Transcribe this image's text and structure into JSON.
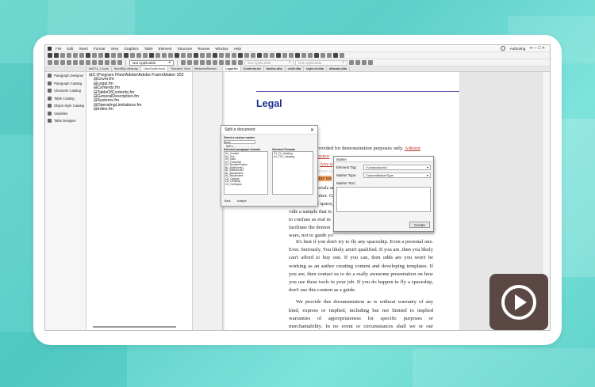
{
  "menu": [
    "File",
    "Edit",
    "Insert",
    "Format",
    "View",
    "Graphics",
    "Table",
    "Element",
    "Structure",
    "Review",
    "Window",
    "Help"
  ],
  "workspace_mode": "Authoring",
  "toolbar": {
    "selector1": "Not Applicable",
    "selector2": "Not Applicable",
    "selector3": "Not Applicable"
  },
  "left_panel": [
    "Paragraph Designer",
    "Paragraph Catalog",
    "Character Catalog",
    "Table Catalog",
    "Object Style Catalog",
    "Variables",
    "Table Designer"
  ],
  "mid_tabs": [
    "lab074_1.book",
    "WorkBkp.ditamap",
    "UserGuide.book",
    "Structure View"
  ],
  "tree": {
    "root": "C:\\Program Files\\Adobe\\Adobe FrameMaker 202",
    "files": [
      "Cover.fm",
      "Legal.fm",
      "Contents.fm",
      "TableOfContents.fm",
      "GeneralDescription.fm",
      "Systems.fm",
      "OperatingLimitations.fm",
      "Index.fm"
    ]
  },
  "doc_strip_title": "WelcomeScreen",
  "doc_tabs": [
    "Legal.fm",
    "Contents.fm",
    "taskbx.dita",
    "vesft.dita",
    "topicref.dita",
    "ditavals.dita"
  ],
  "document": {
    "title": "Legal",
    "frag1a": "rovided for demonstration purposes only. ",
    "frag1b": "Admini",
    "frag2": "erator",
    "frag3a": ". ",
    "frag3b": "Any u",
    "frag4": "Your lu",
    "frag5": "our we",
    "frag6": "erials ar",
    "frag7": "biter. Gr",
    "frag8": "l space,",
    "frag9": "vide a sample that is",
    "frag10": "to confuse as real m",
    "frag11": "facilitate the demon",
    "frag12": "ware, not to guide yo",
    "para1": "It's best if you don't try to fly any spaceship. Even a personal one. Ever. Seriously. You likely aren't qualified. If you are, then you likely can't afford to buy one. If you can, then odds are you won't be working as an author creating content and developing templates. If you are, then contact us to do a really awesome presentation on how you use these tools in your job. If you do happen to fly a spaceship, don't use this content as a guide.",
    "para2": "We provide this documentation as is without warranty of any kind, express or implied, including but not limited to implied warranties of appropriateness for specific purposes or merchantability. In no event or circumstances shall we or our suppliers or distributors be liable for any damages whatsoever, including and without limitation, damages resulting from business loss, which"
  },
  "split_dialog": {
    "title": "Split a document",
    "select_label": "Select a custom marker",
    "select_value": "None",
    "level_value": "AND ▾",
    "col1_title": "Selected paragraph formats",
    "col1_items": [
      "H1_Content",
      "H2_Sub",
      "H3_Lead",
      "HT_FrameSet",
      "H1_NumberSection",
      "BL_BulletLevel1",
      "BL_BulletLevel2",
      "BL_BlockIndent",
      "BL_BlockIndent",
      "CA_Callouts",
      "CE_CellBody",
      "CE_CellSpace"
    ],
    "col2_title": "Selected Formats",
    "col2_items": [
      "H1_Ch_Heading",
      "H1_TOC_Heading"
    ],
    "back": "Back",
    "analyze": "Analyze"
  },
  "marker_dialog": {
    "title": "Marker",
    "element_tag_label": "Element Tag:",
    "element_tag_value": "<Unstructured>",
    "marker_type_label": "Marker Type:",
    "marker_type_value": "CustomMarkerType",
    "marker_text_label": "Marker Text:",
    "create": "Create"
  },
  "colors": {
    "title_blue": "#1a2f8a",
    "link_red": "#c0392b",
    "highlight": "#f0a060",
    "play_bg": "#5b4844"
  }
}
